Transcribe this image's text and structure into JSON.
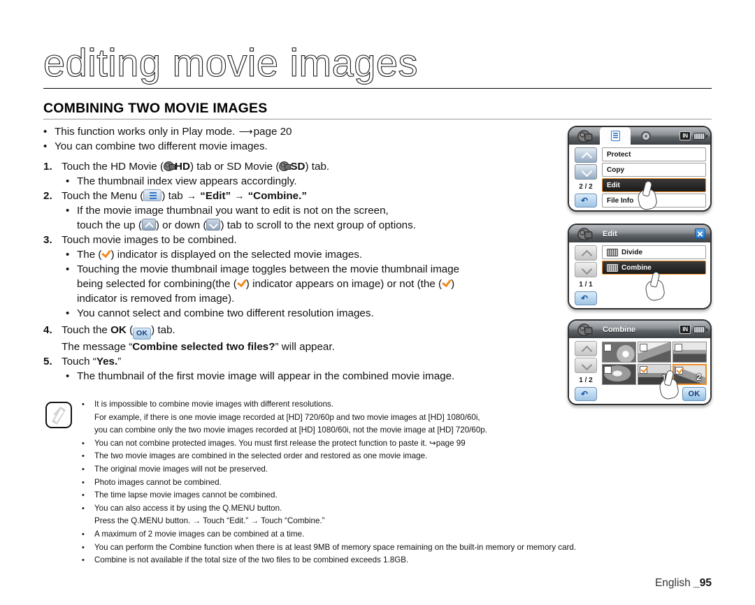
{
  "header": {
    "title": "editing movie images",
    "section_title": "COMBINING TWO MOVIE IMAGES"
  },
  "intro_bullets": [
    {
      "pre": "This function works only in Play mode. ",
      "ref": "page 20"
    },
    {
      "pre": "You can combine two different movie images.",
      "ref": ""
    }
  ],
  "steps": {
    "s1_num": "1.",
    "s1_a": "Touch the HD Movie (",
    "s1_hd": "HD",
    "s1_b": ") tab or SD Movie (",
    "s1_sd": "SD",
    "s1_c": ") tab.",
    "s1_sub": "The thumbnail index view appears accordingly.",
    "s2_num": "2.",
    "s2_a": "Touch the Menu (",
    "s2_b": ") tab ",
    "s2_arrow1": "→",
    "s2_edit": "“Edit”",
    "s2_arrow2": "→",
    "s2_combine": "“Combine.”",
    "s2_sub1": "If the movie image thumbnail you want to edit is not on the screen,",
    "s2_sub2_a": "touch the up (",
    "s2_sub2_b": ") or down (",
    "s2_sub2_c": ") tab to scroll to the next group of options.",
    "s3_num": "3.",
    "s3_a": "Touch movie images to be combined.",
    "s3_sub1_a": "The (",
    "s3_sub1_b": ") indicator is displayed on the selected movie images.",
    "s3_sub2_l1": "Touching the movie thumbnail image toggles between the movie thumbnail image",
    "s3_sub2_l2_a": "being selected for combining(the (",
    "s3_sub2_l2_b": ") indicator appears on image) or not (the (",
    "s3_sub2_l2_c": ")",
    "s3_sub2_l3": "indicator is removed from image).",
    "s3_sub3": "You cannot select and combine two different resolution images.",
    "s4_num": "4.",
    "s4_a": "Touch the ",
    "s4_ok": "OK",
    "s4_b": " (",
    "s4_ok_chip": "OK",
    "s4_c": ") tab.",
    "s4_msg_a": "The message “",
    "s4_msg_bold": "Combine selected two files?",
    "s4_msg_b": "” will appear.",
    "s5_num": "5.",
    "s5_a": "Touch “",
    "s5_yes": "Yes.",
    "s5_b": "”",
    "s5_sub": "The thumbnail of the first movie image will appear in the combined movie image."
  },
  "notes": [
    {
      "lines": [
        "It is impossible to combine movie images with different resolutions.",
        "For example, if there is one movie image recorded at [HD] 720/60p and two movie images at [HD] 1080/60i,",
        "you can combine only the two movie images recorded at [HD] 1080/60i, not the movie image at [HD] 720/60p."
      ]
    },
    {
      "lines": [
        "You can not combine protected images. You must first release the protect function to paste it. ↪page 99"
      ]
    },
    {
      "lines": [
        "The two movie images are combined in the selected order and restored as one movie image."
      ]
    },
    {
      "lines": [
        "The original movie images will not be preserved."
      ]
    },
    {
      "lines": [
        "Photo images cannot be combined."
      ]
    },
    {
      "lines": [
        "The time lapse movie images cannot be combined."
      ]
    },
    {
      "lines": [
        "You can also access it by using the Q.MENU button.",
        "Press the Q.MENU button. → Touch “Edit.” → Touch “Combine.”"
      ]
    },
    {
      "lines": [
        "A maximum of 2 movie images can be combined at a time."
      ]
    },
    {
      "lines": [
        "You can perform the Combine function when there is at least 9MB of memory space remaining on the built-in memory or memory card."
      ]
    },
    {
      "lines": [
        "Combine is not available if the total size of the two files to be combined exceeds 1.8GB."
      ]
    }
  ],
  "screens": {
    "screen1": {
      "in_badge": "IN",
      "page_count": "2 / 2",
      "items": [
        {
          "label": "Protect",
          "selected": false
        },
        {
          "label": "Copy",
          "selected": false
        },
        {
          "label": "Edit",
          "selected": true
        },
        {
          "label": "File Info",
          "selected": false
        }
      ]
    },
    "screen2": {
      "title": "Edit",
      "page_count": "1 / 1",
      "items": [
        {
          "label": "Divide",
          "selected": false
        },
        {
          "label": "Combine",
          "selected": true
        }
      ]
    },
    "screen3": {
      "title": "Combine",
      "in_badge": "IN",
      "page_count": "1 / 2",
      "ok_label": "OK",
      "thumbs": [
        {
          "checked": false,
          "number": ""
        },
        {
          "checked": false,
          "number": ""
        },
        {
          "checked": false,
          "number": ""
        },
        {
          "checked": false,
          "number": ""
        },
        {
          "checked": true,
          "number": "1"
        },
        {
          "checked": true,
          "number": "2"
        }
      ]
    }
  },
  "footer": {
    "lang": "English ",
    "page": "_95"
  },
  "colors": {
    "accent_orange": "#ee8b22",
    "accent_blue": "#2f77c9"
  }
}
